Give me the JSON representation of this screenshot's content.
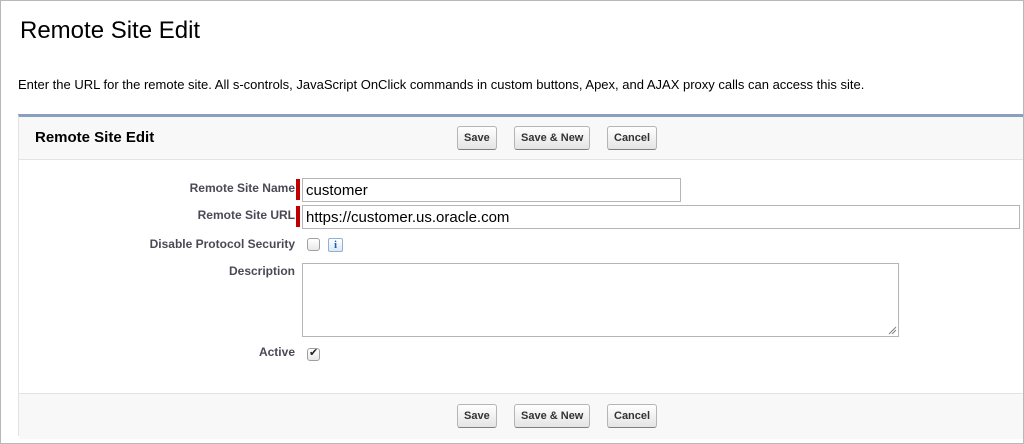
{
  "page": {
    "title": "Remote Site Edit",
    "description": "Enter the URL for the remote site. All s-controls, JavaScript OnClick commands in custom buttons, Apex, and AJAX proxy calls can access this site."
  },
  "panel": {
    "title": "Remote Site Edit"
  },
  "buttons": {
    "save": "Save",
    "save_new": "Save & New",
    "cancel": "Cancel"
  },
  "form": {
    "remote_site_name": {
      "label": "Remote Site Name",
      "value": "customer",
      "required": true
    },
    "remote_site_url": {
      "label": "Remote Site URL",
      "value": "https://customer.us.oracle.com",
      "required": true
    },
    "disable_protocol_security": {
      "label": "Disable Protocol Security",
      "checked": false,
      "info_icon": "i"
    },
    "description": {
      "label": "Description",
      "value": ""
    },
    "active": {
      "label": "Active",
      "checked": true
    }
  },
  "colors": {
    "required": "#c00000",
    "panel_accent": "#8a9ebe",
    "label_text": "#4a4a56"
  }
}
